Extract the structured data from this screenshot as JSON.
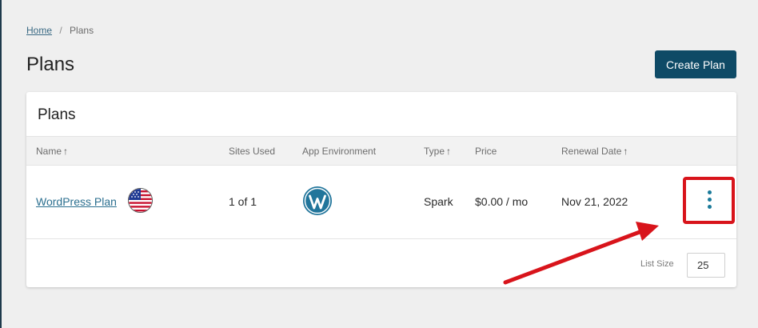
{
  "breadcrumb": {
    "home": "Home",
    "separator": "/",
    "current": "Plans"
  },
  "page": {
    "title": "Plans",
    "create_button": "Create Plan"
  },
  "card": {
    "title": "Plans",
    "columns": {
      "name": "Name",
      "sites_used": "Sites Used",
      "app_environment": "App Environment",
      "type": "Type",
      "price": "Price",
      "renewal_date": "Renewal Date"
    },
    "sort_arrow": "↑",
    "rows": [
      {
        "name": "WordPress Plan",
        "flag_icon": "us-flag-icon",
        "sites_used": "1 of 1",
        "app_environment_icon": "wordpress-icon",
        "type": "Spark",
        "price": "$0.00 / mo",
        "renewal_date": "Nov 21, 2022",
        "actions_icon": "kebab-menu-icon"
      }
    ],
    "footer": {
      "list_size_label": "List Size",
      "list_size_value": "25"
    }
  },
  "colors": {
    "primary_button": "#0e4a66",
    "link": "#2b6f8f",
    "annotation": "#d8141b",
    "kebab": "#1a7a9a"
  }
}
